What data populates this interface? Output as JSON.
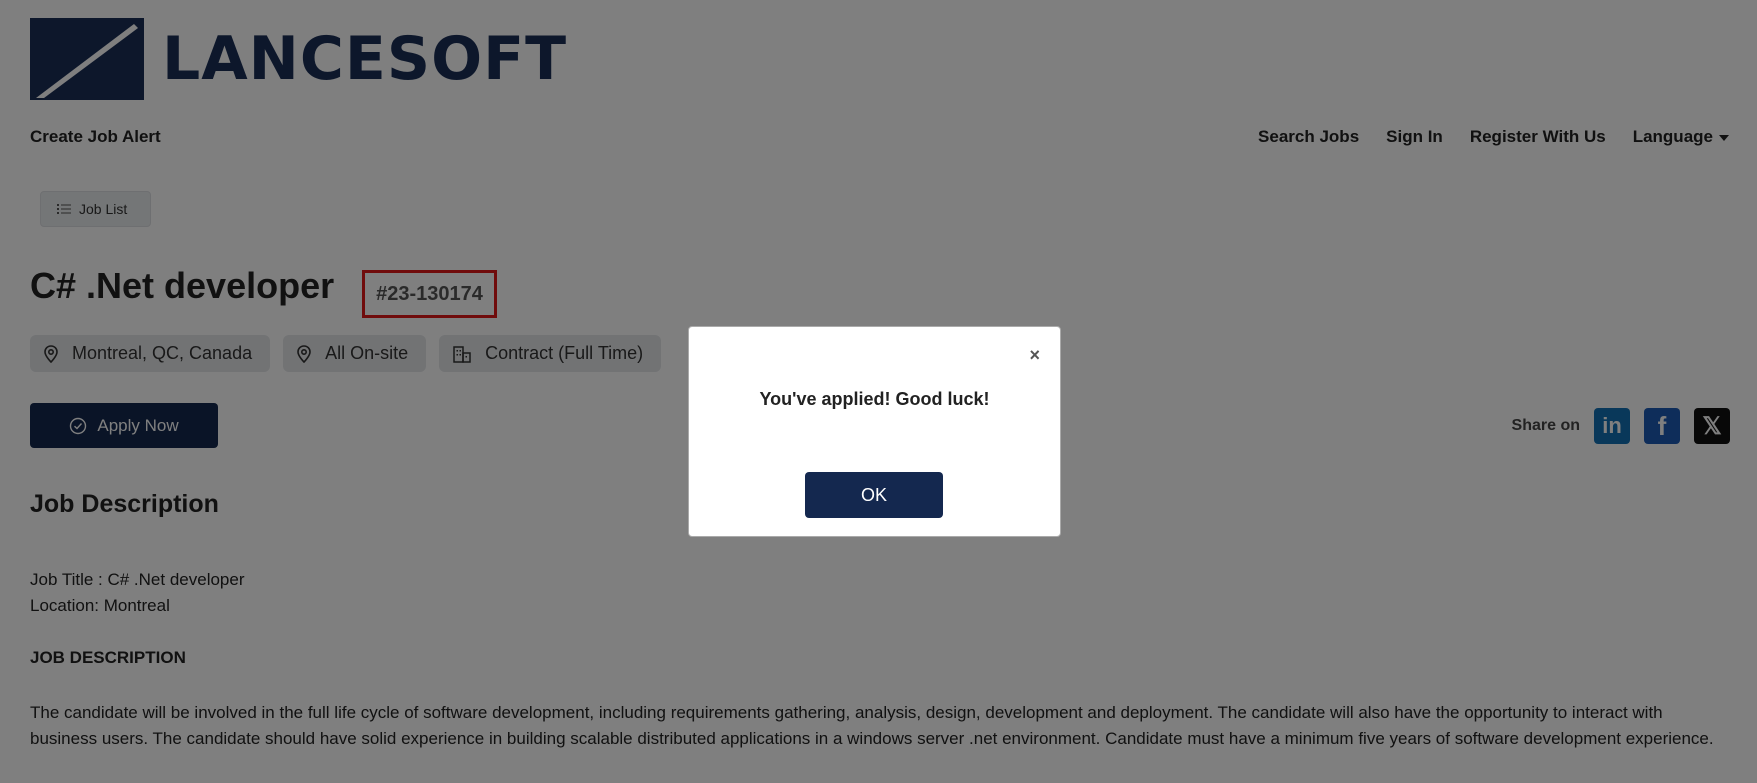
{
  "brand": {
    "name": "LANCESOFT",
    "color": "#1b2f57"
  },
  "nav": {
    "left": "Create Job Alert",
    "right": [
      "Search Jobs",
      "Sign In",
      "Register With Us",
      "Language"
    ]
  },
  "job_list_button": "Job List",
  "job": {
    "title": "C# .Net developer",
    "id": "#23-130174",
    "tags": [
      {
        "label": "Montreal, QC, Canada",
        "icon": "map-pin-icon"
      },
      {
        "label": "All On-site",
        "icon": "map-pin-icon"
      },
      {
        "label": "Contract (Full Time)",
        "icon": "building-icon"
      }
    ],
    "apply_label": "Apply Now"
  },
  "share": {
    "label": "Share on",
    "networks": [
      {
        "name": "linkedin-icon",
        "glyph": "in"
      },
      {
        "name": "facebook-icon",
        "glyph": "f"
      },
      {
        "name": "x-icon",
        "glyph": "𝕏"
      }
    ]
  },
  "description": {
    "heading": "Job Description",
    "line1": "Job Title : C# .Net developer",
    "line2": "Location: Montreal",
    "subheading": "JOB DESCRIPTION",
    "paragraph": "The candidate will be involved in the full life cycle of software development, including requirements gathering, analysis, design, development and deployment. The candidate will also have the opportunity to interact with business users. The candidate should have solid experience in building scalable distributed applications in a windows server .net environment. Candidate must have a minimum five years of software development experience."
  },
  "modal": {
    "close_glyph": "×",
    "message": "You've applied! Good luck!",
    "ok_label": "OK"
  },
  "colors": {
    "primary": "#14284f",
    "highlight": "#e01818",
    "overlay": "rgba(0,0,0,0.5)"
  }
}
